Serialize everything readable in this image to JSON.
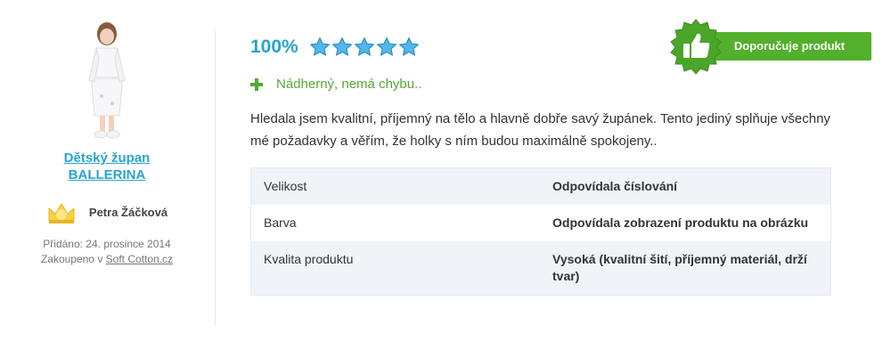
{
  "product": {
    "name": "Dětský župan BALLERINA"
  },
  "reviewer": {
    "name": "Petra Žáčková"
  },
  "meta": {
    "added": "Přidáno: 24. prosince 2014",
    "purchased_prefix": "Zakoupeno v",
    "shop": "Soft Cotton.cz"
  },
  "rating": {
    "percent": "100%",
    "stars": 5
  },
  "recommend": {
    "label": "Doporučuje produkt"
  },
  "pros": {
    "text": "Nádherný, nemá chybu.."
  },
  "review": {
    "text": "Hledala jsem kvalitní, příjemný na tělo a hlavně dobře savý župánek. Tento jediný splňuje všechny mé požadavky a věřím, že holky s ním budou maximálně spokojeny.."
  },
  "params": [
    {
      "label": "Velikost",
      "value": "Odpovídala číslování"
    },
    {
      "label": "Barva",
      "value": "Odpovídala zobrazení produktu na obrázku"
    },
    {
      "label": "Kvalita produktu",
      "value": "Vysoká (kvalitní šití, příjemný materiál, drží tvar)"
    }
  ],
  "colors": {
    "accent": "#2aa3cf",
    "green": "#52b02c",
    "pros_green": "#52a936",
    "table_stripe": "#eff4f7"
  },
  "icons": {
    "stars": "star-icon",
    "pros": "plus-icon",
    "badge": "thumbs-up-icon",
    "reviewer": "crown-avatar-icon"
  }
}
